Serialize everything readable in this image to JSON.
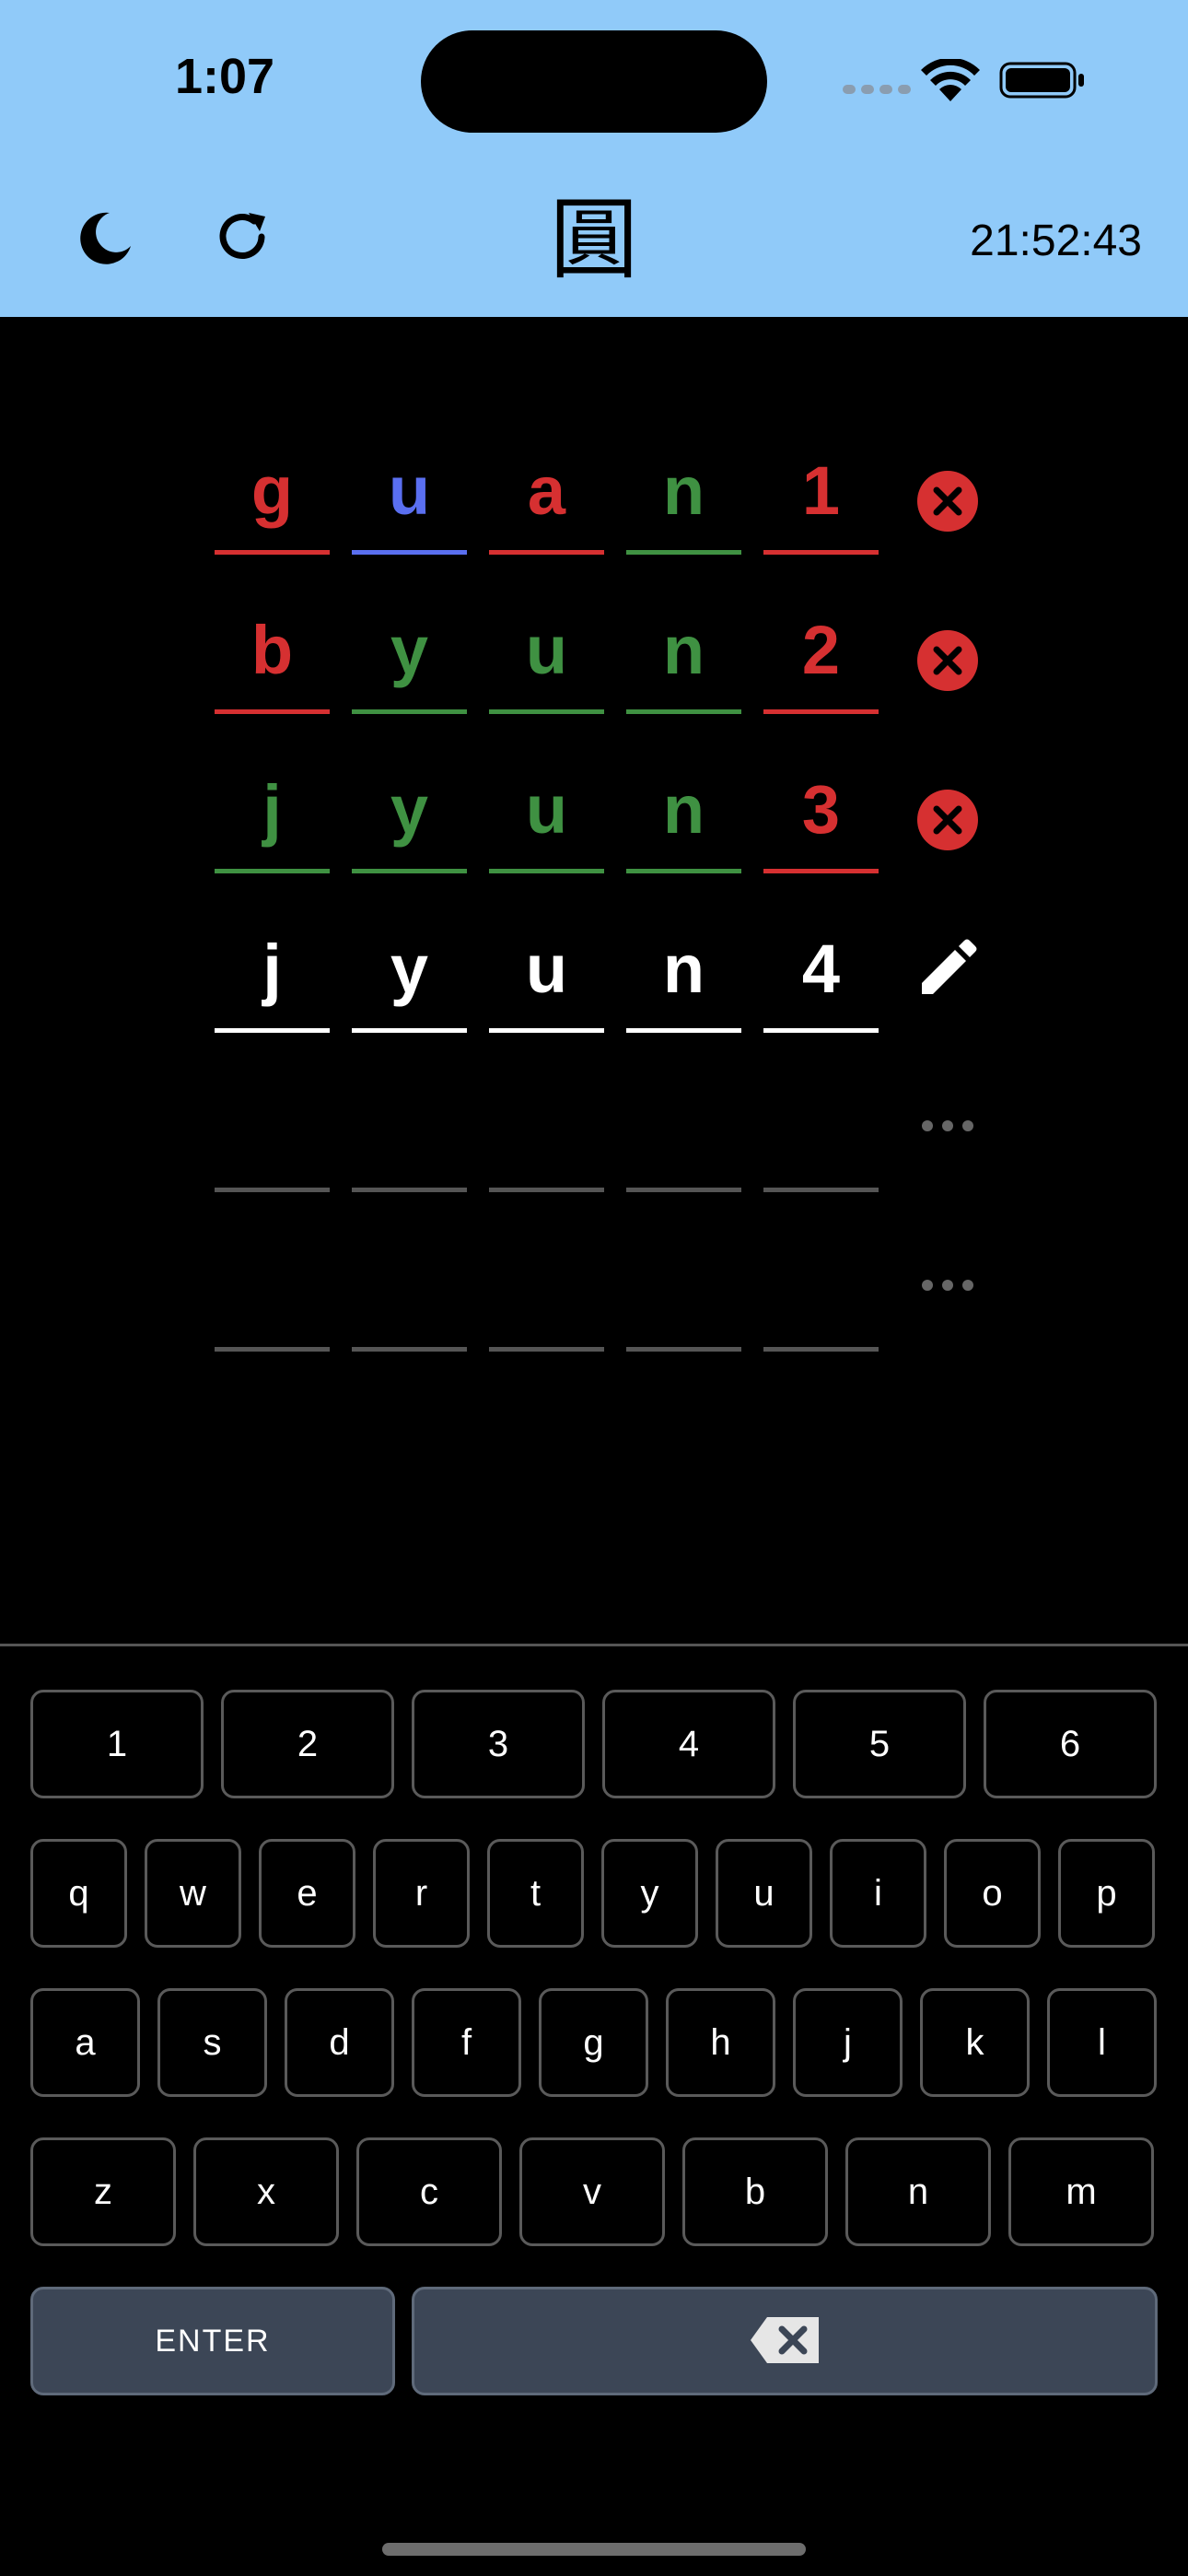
{
  "status_bar": {
    "time": "1:07"
  },
  "header": {
    "theme_toggle_icon": "moon-icon",
    "refresh_icon": "refresh-icon",
    "logo": "圓",
    "timer": "21:52:43",
    "bg_color": "#90caf9"
  },
  "colors": {
    "correct": "#3f9142",
    "present": "#5a6ff0",
    "absent": "#d63031",
    "active": "#ffffff",
    "empty": "#555555"
  },
  "board": {
    "rows": [
      {
        "status": "wrong",
        "status_icon": "x-circle-icon",
        "tiles": [
          {
            "letter": "g",
            "state": "absent"
          },
          {
            "letter": "u",
            "state": "present"
          },
          {
            "letter": "a",
            "state": "absent"
          },
          {
            "letter": "n",
            "state": "correct"
          },
          {
            "letter": "1",
            "state": "absent"
          }
        ]
      },
      {
        "status": "wrong",
        "status_icon": "x-circle-icon",
        "tiles": [
          {
            "letter": "b",
            "state": "absent"
          },
          {
            "letter": "y",
            "state": "correct"
          },
          {
            "letter": "u",
            "state": "correct"
          },
          {
            "letter": "n",
            "state": "correct"
          },
          {
            "letter": "2",
            "state": "absent"
          }
        ]
      },
      {
        "status": "wrong",
        "status_icon": "x-circle-icon",
        "tiles": [
          {
            "letter": "j",
            "state": "correct"
          },
          {
            "letter": "y",
            "state": "correct"
          },
          {
            "letter": "u",
            "state": "correct"
          },
          {
            "letter": "n",
            "state": "correct"
          },
          {
            "letter": "3",
            "state": "absent"
          }
        ]
      },
      {
        "status": "editing",
        "status_icon": "pencil-icon",
        "tiles": [
          {
            "letter": "j",
            "state": "active"
          },
          {
            "letter": "y",
            "state": "active"
          },
          {
            "letter": "u",
            "state": "active"
          },
          {
            "letter": "n",
            "state": "active"
          },
          {
            "letter": "4",
            "state": "active"
          }
        ]
      },
      {
        "status": "pending",
        "status_icon": "ellipsis-icon",
        "tiles": [
          {
            "letter": "",
            "state": "empty"
          },
          {
            "letter": "",
            "state": "empty"
          },
          {
            "letter": "",
            "state": "empty"
          },
          {
            "letter": "",
            "state": "empty"
          },
          {
            "letter": "",
            "state": "empty"
          }
        ]
      },
      {
        "status": "pending",
        "status_icon": "ellipsis-icon",
        "tiles": [
          {
            "letter": "",
            "state": "empty"
          },
          {
            "letter": "",
            "state": "empty"
          },
          {
            "letter": "",
            "state": "empty"
          },
          {
            "letter": "",
            "state": "empty"
          },
          {
            "letter": "",
            "state": "empty"
          }
        ]
      }
    ]
  },
  "keyboard": {
    "rows": [
      [
        "1",
        "2",
        "3",
        "4",
        "5",
        "6"
      ],
      [
        "q",
        "w",
        "e",
        "r",
        "t",
        "y",
        "u",
        "i",
        "o",
        "p"
      ],
      [
        "a",
        "s",
        "d",
        "f",
        "g",
        "h",
        "j",
        "k",
        "l"
      ],
      [
        "z",
        "x",
        "c",
        "v",
        "b",
        "n",
        "m"
      ]
    ],
    "enter_label": "ENTER",
    "backspace_icon": "backspace-icon"
  }
}
